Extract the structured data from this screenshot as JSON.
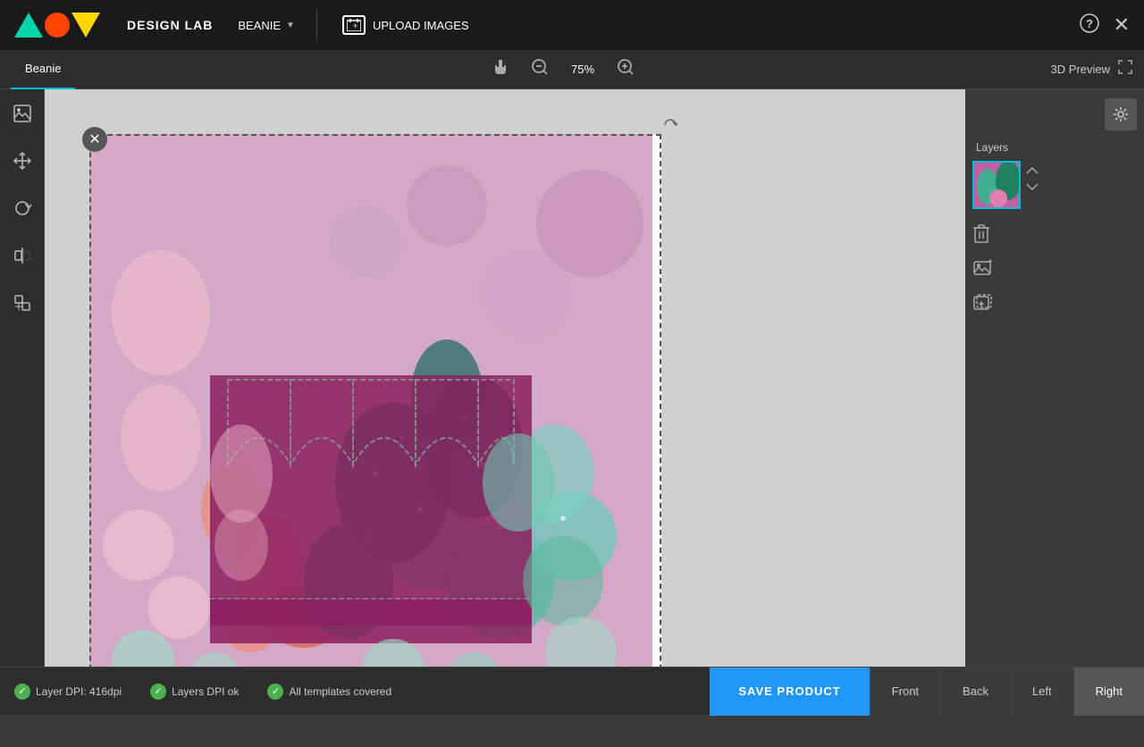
{
  "app": {
    "name": "DESIGN LAB",
    "logo": "AoW"
  },
  "product": {
    "name": "BEANIE",
    "dropdown": true
  },
  "nav": {
    "upload_label": "UPLOAD IMAGES",
    "help_icon": "?",
    "close_icon": "×"
  },
  "toolbar": {
    "tab_label": "Beanie",
    "zoom_level": "75%",
    "preview_label": "3D Preview",
    "pan_icon": "✋",
    "zoom_out_icon": "−",
    "zoom_in_icon": "+"
  },
  "layers": {
    "label": "Layers",
    "settings_icon": "⚙"
  },
  "layer_controls": {
    "up_arrow": "▲",
    "down_arrow": "▼",
    "delete_icon": "🗑",
    "replace_icon": "🖼",
    "add_icon": "+"
  },
  "status_bar": {
    "dpi_label": "Layer DPI: 416dpi",
    "layers_ok_label": "Layers DPI ok",
    "templates_label": "All templates covered",
    "save_button": "SAVE PRODUCT"
  },
  "view_buttons": {
    "front": "Front",
    "back": "Back",
    "left": "Left",
    "right": "Right"
  },
  "colors": {
    "accent": "#2196f3",
    "success": "#4caf50",
    "active_tab": "#00bcd4",
    "bg_dark": "#1a1a1a",
    "bg_mid": "#2d2d2d",
    "bg_light": "#3a3a3a"
  }
}
